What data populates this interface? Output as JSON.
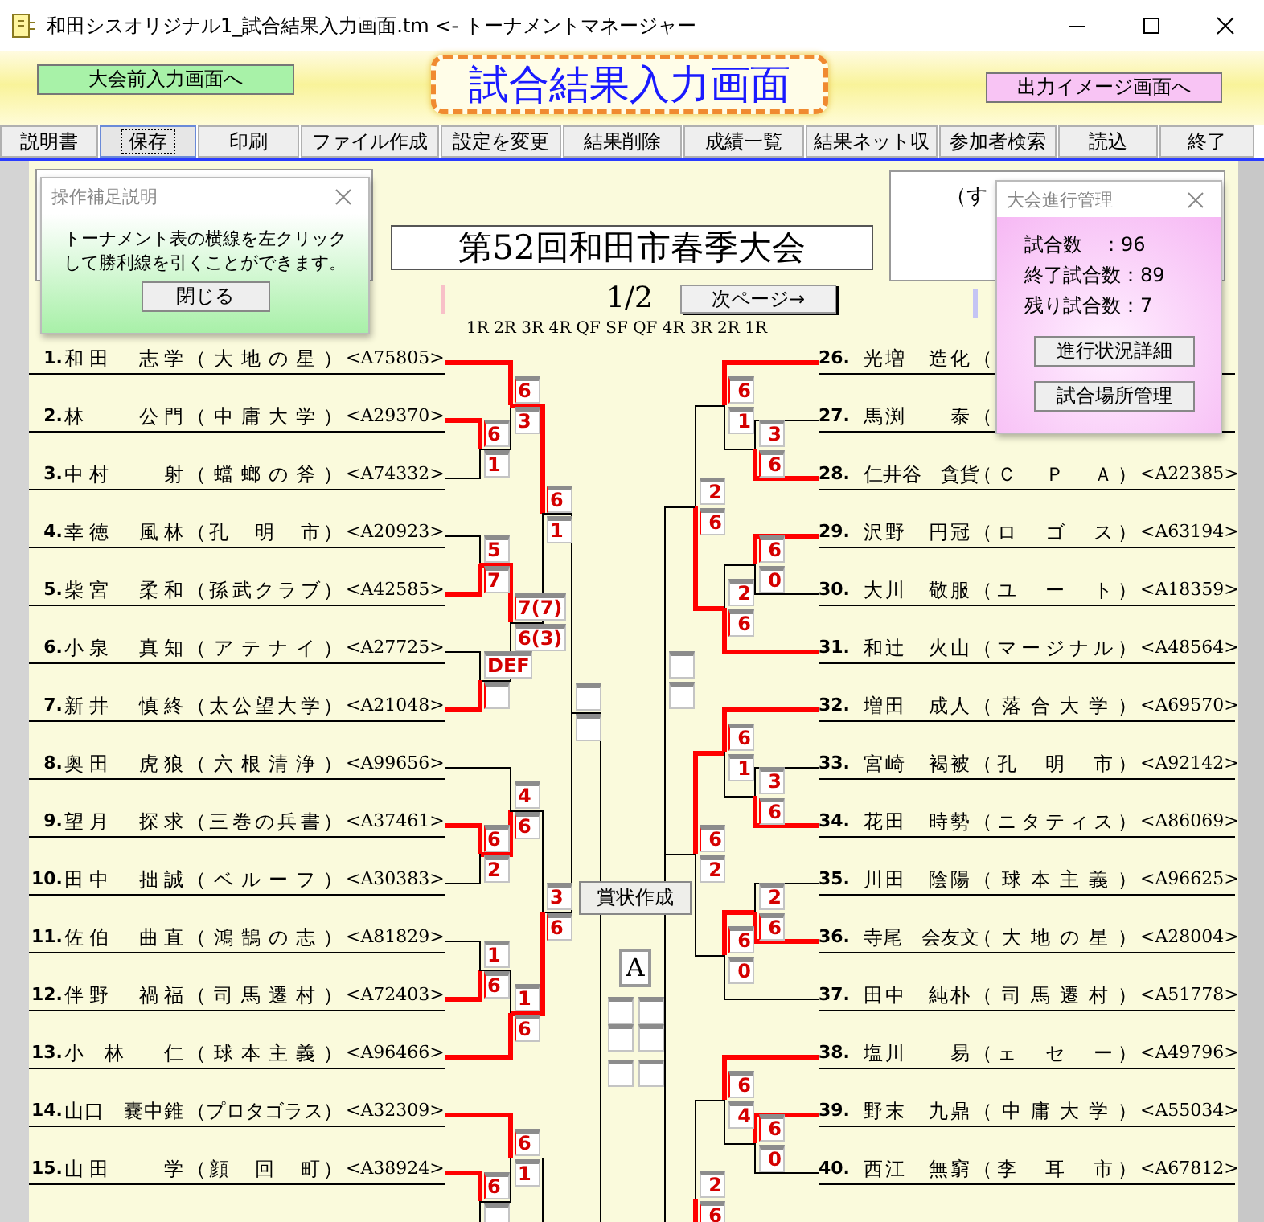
{
  "window": {
    "title": "和田シスオリジナル1_試合結果入力画面.tm <- トーナメントマネージャー"
  },
  "toolbar": {
    "left_button": "大会前入力画面へ",
    "heading": "試合結果入力画面",
    "right_button": "出力イメージ画面へ"
  },
  "menu": [
    {
      "label": "説明書",
      "focused": false
    },
    {
      "label": "保存",
      "focused": true
    },
    {
      "label": "印刷",
      "focused": false
    },
    {
      "label": "ファイル作成",
      "focused": false
    },
    {
      "label": "設定を変更",
      "focused": false
    },
    {
      "label": "結果削除",
      "focused": false
    },
    {
      "label": "成績一覧",
      "focused": false
    },
    {
      "label": "結果ネット収",
      "focused": false
    },
    {
      "label": "参加者検索",
      "focused": false
    },
    {
      "label": "読込",
      "focused": false
    },
    {
      "label": "終了",
      "focused": false
    }
  ],
  "tournament": {
    "title": "第52回和田市春季大会",
    "page": "1/2",
    "next_button": "次ページ→",
    "rounds": "1R 2R 3R 4R QF SF QF 4R 3R 2R 1R"
  },
  "side_panel_text": "（す",
  "left_players": [
    {
      "no": "1.",
      "name": "和田　志学",
      "team": "（大地の星）",
      "code": "<A75805>"
    },
    {
      "no": "2.",
      "name": "林　　公門",
      "team": "（中庸大学）",
      "code": "<A29370>"
    },
    {
      "no": "3.",
      "name": "中村　　射",
      "team": "（蟷螂の斧）",
      "code": "<A74332>"
    },
    {
      "no": "4.",
      "name": "幸徳　風林",
      "team": "（孔　明　市）",
      "code": "<A20923>"
    },
    {
      "no": "5.",
      "name": "柴宮　柔和",
      "team": "（孫武クラブ）",
      "code": "<A42585>"
    },
    {
      "no": "6.",
      "name": "小泉　真知",
      "team": "（アテナイ）",
      "code": "<A27725>"
    },
    {
      "no": "7.",
      "name": "新井　慎終",
      "team": "（太公望大学）",
      "code": "<A21048>"
    },
    {
      "no": "8.",
      "name": "奥田　虎狼",
      "team": "（六根清浄）",
      "code": "<A99656>"
    },
    {
      "no": "9.",
      "name": "望月　探求",
      "team": "（三巻の兵書）",
      "code": "<A37461>"
    },
    {
      "no": "10.",
      "name": "田中　拙誠",
      "team": "（ベルーフ）",
      "code": "<A30383>"
    },
    {
      "no": "11.",
      "name": "佐伯　曲直",
      "team": "（鴻鵠の志）",
      "code": "<A81829>"
    },
    {
      "no": "12.",
      "name": "伴野　禍福",
      "team": "（司馬遷村）",
      "code": "<A72403>"
    },
    {
      "no": "13.",
      "name": "小　林　　仁",
      "team": "（球本主義）",
      "code": "<A96466>"
    },
    {
      "no": "14.",
      "name": "山口　嚢中錐",
      "team": "（プロタゴラス）",
      "code": "<A32309>"
    },
    {
      "no": "15.",
      "name": "山田　　学",
      "team": "（顔　回　町）",
      "code": "<A38924>"
    }
  ],
  "right_players": [
    {
      "no": "26.",
      "name": "光増　造化",
      "team": "（"
    },
    {
      "no": "27.",
      "name": "馬渕　　泰",
      "team": "（"
    },
    {
      "no": "28.",
      "name": "仁井谷　貪貨",
      "team": "（Ｃ　Ｐ　Ａ）",
      "code": "<A22385>"
    },
    {
      "no": "29.",
      "name": "沢野　円冠",
      "team": "（ロ　ゴ　ス）",
      "code": "<A63194>"
    },
    {
      "no": "30.",
      "name": "大川　敬服",
      "team": "（ユ　ー　ト）",
      "code": "<A18359>"
    },
    {
      "no": "31.",
      "name": "和辻　火山",
      "team": "（マージナル）",
      "code": "<A48564>"
    },
    {
      "no": "32.",
      "name": "増田　成人",
      "team": "（落合大学）",
      "code": "<A69570>"
    },
    {
      "no": "33.",
      "name": "宮崎　褐被",
      "team": "（孔　明　市）",
      "code": "<A92142>"
    },
    {
      "no": "34.",
      "name": "花田　時勢",
      "team": "（ニタティス）",
      "code": "<A86069>"
    },
    {
      "no": "35.",
      "name": "川田　陰陽",
      "team": "（球本主義）",
      "code": "<A96625>"
    },
    {
      "no": "36.",
      "name": "寺尾　会友文",
      "team": "（大地の星）",
      "code": "<A28004>"
    },
    {
      "no": "37.",
      "name": "田中　純朴",
      "team": "（司馬遷村）",
      "code": "<A51778>"
    },
    {
      "no": "38.",
      "name": "塩川　　易",
      "team": "（ェ　セ　ー）",
      "code": "<A49796>"
    },
    {
      "no": "39.",
      "name": "野末　九鼎",
      "team": "（中庸大学）",
      "code": "<A55034>"
    },
    {
      "no": "40.",
      "name": "西江　無窮",
      "team": "（李　耳　市）",
      "code": "<A67812>"
    }
  ],
  "left_matches": [
    {
      "top": {
        "score": "6",
        "won": true
      },
      "bottom": {
        "score": "3",
        "won": false
      }
    },
    {
      "top": {
        "score": "6",
        "won": true
      },
      "bottom": {
        "score": "1",
        "won": false
      }
    },
    {
      "top": {
        "score": "6",
        "won": true
      },
      "bottom": {
        "score": "1",
        "won": false
      }
    },
    {
      "top": {
        "score": "5",
        "won": false
      },
      "bottom": {
        "score": "7",
        "won": true
      }
    },
    {
      "top": {
        "score": "7(7)",
        "won": true
      },
      "bottom": {
        "score": "6(3)",
        "won": false
      }
    },
    {
      "top": {
        "score": "DEF",
        "won": false
      },
      "bottom": {
        "won": true
      }
    },
    {
      "top": {
        "won": false
      },
      "bottom": {
        "won": false
      }
    },
    {
      "top": {
        "score": "4",
        "won": false
      },
      "bottom": {
        "score": "6",
        "won": true
      }
    },
    {
      "top": {
        "score": "6",
        "won": true
      },
      "bottom": {
        "score": "2",
        "won": false
      }
    },
    {
      "top": {
        "score": "3",
        "won": false
      },
      "bottom": {
        "score": "6",
        "won": true
      }
    },
    {
      "top": {
        "score": "1",
        "won": false
      },
      "bottom": {
        "score": "6",
        "won": true
      }
    },
    {
      "top": {
        "score": "1",
        "won": false
      },
      "bottom": {
        "score": "6",
        "won": true
      }
    },
    {
      "top": {
        "score": "6",
        "won": true
      },
      "bottom": {
        "score": "1",
        "won": false
      }
    },
    {
      "top": {
        "score": "6",
        "won": true
      },
      "bottom": {
        "won": false
      }
    }
  ],
  "right_matches": [
    {
      "top": {
        "score": "6",
        "won": true
      },
      "bottom": {
        "score": "1",
        "won": false
      }
    },
    {
      "top": {
        "score": "3",
        "won": false
      },
      "bottom": {
        "score": "6",
        "won": true
      }
    },
    {
      "top": {
        "score": "2",
        "won": false
      },
      "bottom": {
        "score": "6",
        "won": true
      }
    },
    {
      "top": {
        "score": "6",
        "won": true
      },
      "bottom": {
        "score": "0",
        "won": false
      }
    },
    {
      "top": {
        "score": "2",
        "won": false
      },
      "bottom": {
        "score": "6",
        "won": true
      }
    },
    {
      "top": {
        "won": false
      },
      "bottom": {
        "won": false
      }
    },
    {
      "top": {
        "score": "6",
        "won": true
      },
      "bottom": {
        "score": "1",
        "won": false
      }
    },
    {
      "top": {
        "score": "3",
        "won": false
      },
      "bottom": {
        "score": "6",
        "won": true
      }
    },
    {
      "top": {
        "score": "6",
        "won": true
      },
      "bottom": {
        "score": "2",
        "won": false
      }
    },
    {
      "top": {
        "score": "2",
        "won": false
      },
      "bottom": {
        "score": "6",
        "won": true
      }
    },
    {
      "top": {
        "score": "6",
        "won": true
      },
      "bottom": {
        "score": "0",
        "won": false
      }
    },
    {
      "top": {
        "score": "6",
        "won": true
      },
      "bottom": {
        "score": "4",
        "won": false
      }
    },
    {
      "top": {
        "score": "6",
        "won": true
      },
      "bottom": {
        "score": "0",
        "won": false
      }
    },
    {
      "top": {
        "score": "2",
        "won": false
      },
      "bottom": {
        "score": "6",
        "won": true
      }
    }
  ],
  "center": {
    "certificate_button": "賞状作成",
    "block_label": "A"
  },
  "help_popup": {
    "title": "操作補足説明",
    "lines": [
      "トーナメント表の横線を左クリック",
      "して勝利線を引くことができます。"
    ],
    "button": "閉じる"
  },
  "progress_popup": {
    "title": "大会進行管理",
    "stats": [
      "試合数　：96",
      "終了試合数：89",
      "残り試合数：7"
    ],
    "buttons": [
      "進行状況詳細",
      "試合場所管理"
    ]
  }
}
